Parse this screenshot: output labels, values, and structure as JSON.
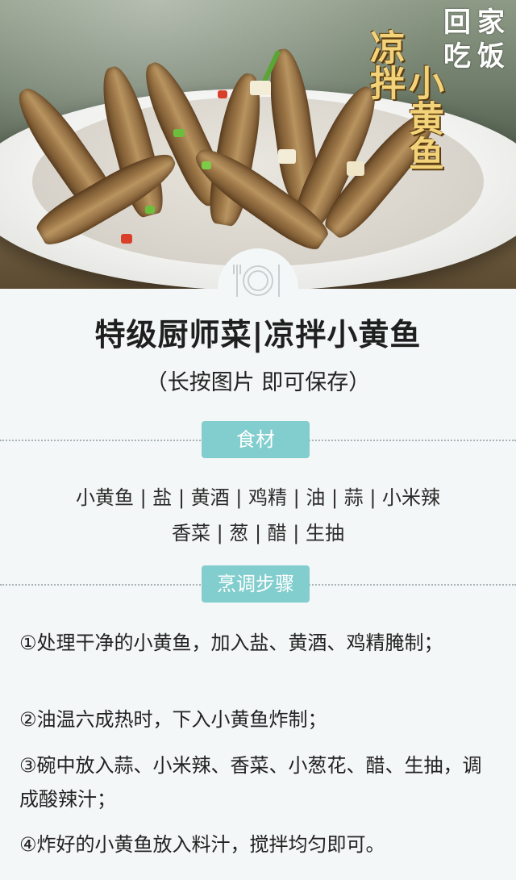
{
  "hero": {
    "vertical_title_1": "凉拌",
    "vertical_title_2": "小黄鱼",
    "logo_chars": [
      "回",
      "家",
      "吃",
      "饭"
    ]
  },
  "title": "特级厨师菜|凉拌小黄鱼",
  "subtitle": "（长按图片  即可保存）",
  "ingredients": {
    "label": "食材",
    "line1": "小黄鱼 | 盐 | 黄酒 | 鸡精 | 油 | 蒜 | 小米辣",
    "line2": "香菜 | 葱 | 醋 | 生抽"
  },
  "steps": {
    "label": "烹调步骤",
    "items": [
      "①处理干净的小黄鱼，加入盐、黄酒、鸡精腌制；",
      "②油温六成热时，下入小黄鱼炸制；",
      "③碗中放入蒜、小米辣、香菜、小葱花、醋、生抽，调成酸辣汁；",
      "④炸好的小黄鱼放入料汁，搅拌均匀即可。"
    ]
  },
  "colors": {
    "accent": "#82cdcd",
    "title_gold": "#f3d37a",
    "background": "#f4f7f7"
  }
}
